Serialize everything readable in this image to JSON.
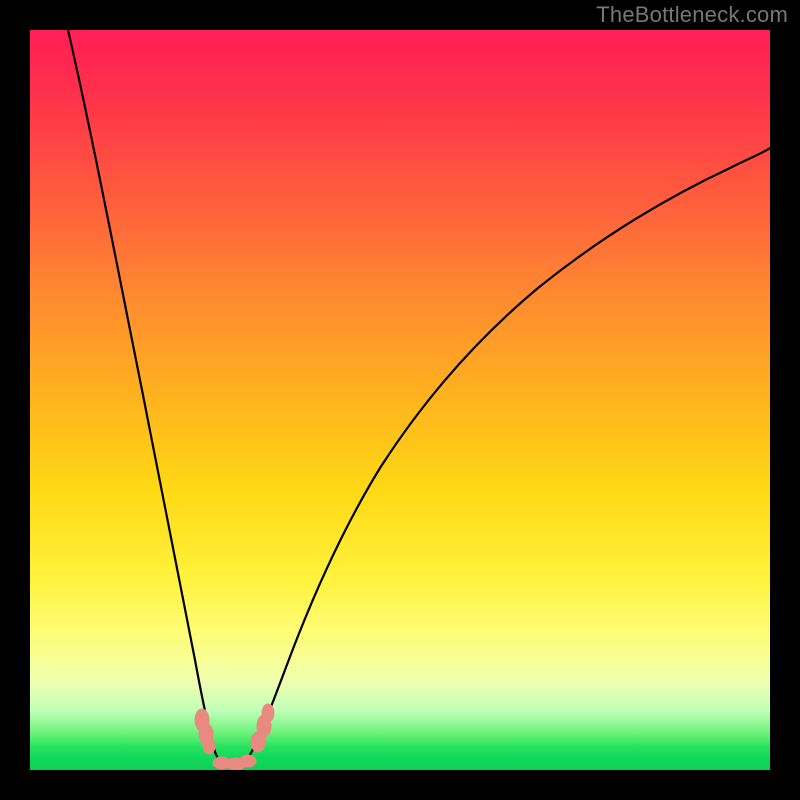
{
  "watermark": "TheBottleneck.com",
  "colors": {
    "background": "#000000",
    "gradient_top": "#ff1f55",
    "gradient_mid": "#ffd814",
    "gradient_bottom": "#0ed058",
    "curve": "#000000",
    "markers": "#e98a80",
    "watermark": "#777777"
  },
  "chart_data": {
    "type": "line",
    "title": "",
    "xlabel": "",
    "ylabel": "",
    "xlim": [
      0,
      100
    ],
    "ylim": [
      0,
      100
    ],
    "note": "Axes are unlabeled; values are pixel-normalized to a 0–100 scale inferred from the plot area. The curve is a V-shaped bottleneck plot with its minimum near x≈26 touching y≈0, rising steeply on both sides.",
    "series": [
      {
        "name": "bottleneck-curve",
        "x": [
          5,
          8,
          11,
          14,
          17,
          20,
          22,
          24,
          25.5,
          27,
          28,
          30,
          33,
          37,
          42,
          48,
          55,
          63,
          72,
          82,
          92,
          100
        ],
        "y": [
          100,
          86,
          72,
          58,
          44,
          30,
          19,
          8,
          1,
          0.6,
          1.5,
          6,
          16,
          29,
          42,
          53,
          62,
          70,
          76,
          81,
          85,
          88
        ]
      }
    ],
    "markers": [
      {
        "name": "left-cluster",
        "x": 23.5,
        "y": 6
      },
      {
        "name": "left-cluster",
        "x": 24.0,
        "y": 3
      },
      {
        "name": "bottom-cluster",
        "x": 26.0,
        "y": 0.8
      },
      {
        "name": "bottom-cluster",
        "x": 28.0,
        "y": 0.8
      },
      {
        "name": "right-cluster",
        "x": 30.5,
        "y": 5
      },
      {
        "name": "right-cluster",
        "x": 31.0,
        "y": 7
      }
    ]
  }
}
